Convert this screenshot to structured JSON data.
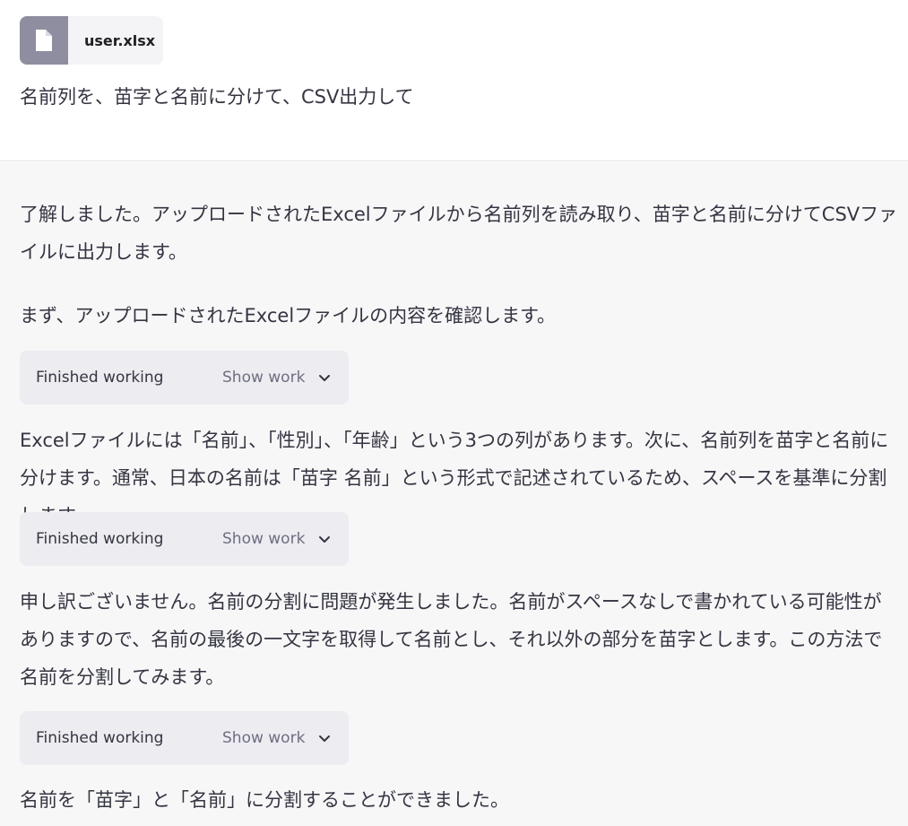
{
  "user": {
    "attachment": {
      "file_name": "user.xlsx",
      "icon": "document-icon"
    },
    "message": "名前列を、苗字と名前に分けて、CSV出力して"
  },
  "assistant": {
    "paragraphs": [
      "了解しました。アップロードされたExcelファイルから名前列を読み取り、苗字と名前に分けてCSVファイルに出力します。",
      "まず、アップロードされたExcelファイルの内容を確認します。",
      "Excelファイルには「名前」、「性別」、「年齢」という3つの列があります。次に、名前列を苗字と名前に分けます。通常、日本の名前は「苗字 名前」という形式で記述されているため、スペースを基準に分割します。",
      "申し訳ございません。名前の分割に問題が発生しました。名前がスペースなしで書かれている可能性がありますので、名前の最後の一文字を取得して名前とし、それ以外の部分を苗字とします。この方法で名前を分割してみます。",
      "名前を「苗字」と「名前」に分割することができました。"
    ],
    "work_blocks": [
      {
        "status": "Finished working",
        "toggle": "Show work",
        "icon": "chevron-down-icon"
      },
      {
        "status": "Finished working",
        "toggle": "Show work",
        "icon": "chevron-down-icon"
      },
      {
        "status": "Finished working",
        "toggle": "Show work",
        "icon": "chevron-down-icon"
      }
    ]
  },
  "colors": {
    "user_bg": "#ffffff",
    "assistant_bg": "#f7f7f8",
    "chip_bg": "#ececf1",
    "file_icon_bg": "#8e8ea0",
    "text": "#343541"
  }
}
